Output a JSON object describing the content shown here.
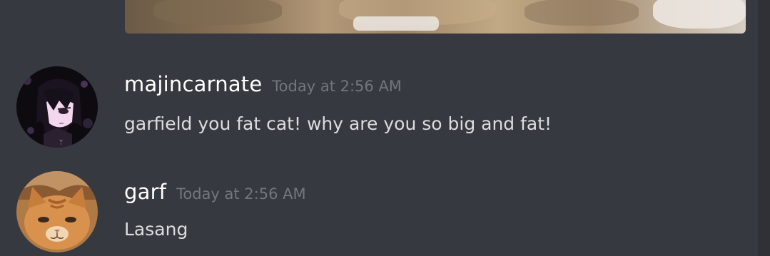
{
  "messages": [
    {
      "author": "majincarnate",
      "timestamp": "Today at 2:56 AM",
      "text": "garfield you fat cat! why are you so big and fat!",
      "avatar_icon": "anime-character-avatar-icon"
    },
    {
      "author": "garf",
      "timestamp": "Today at 2:56 AM",
      "text": "Lasang",
      "avatar_icon": "orange-cat-avatar-icon"
    }
  ],
  "colors": {
    "background": "#36393f",
    "username": "#ffffff",
    "timestamp": "#72767d",
    "message_text": "#dcddde"
  }
}
